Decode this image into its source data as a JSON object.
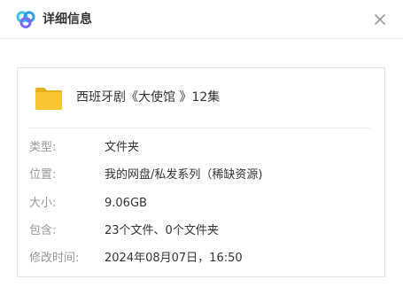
{
  "dialog": {
    "title": "详细信息",
    "logo_icon": "baidu-netdisk-logo",
    "close_icon": "close-icon"
  },
  "file": {
    "icon": "folder-icon",
    "name": "西班牙剧《大使馆 》12集"
  },
  "details": [
    {
      "label": "类型:",
      "value": "文件夹"
    },
    {
      "label": "位置:",
      "value": "我的网盘/私发系列（稀缺资源)"
    },
    {
      "label": "大小:",
      "value": "9.06GB"
    },
    {
      "label": "包含:",
      "value": "23个文件、0个文件夹"
    },
    {
      "label": "修改时间:",
      "value": "2024年08月07日，16:50"
    }
  ],
  "colors": {
    "folder": "#F9C431",
    "label": "#999999",
    "text": "#333333",
    "logo_blue": "#2E9BF0",
    "logo_cyan": "#37C6E6",
    "logo_purple": "#7A6CF0"
  }
}
